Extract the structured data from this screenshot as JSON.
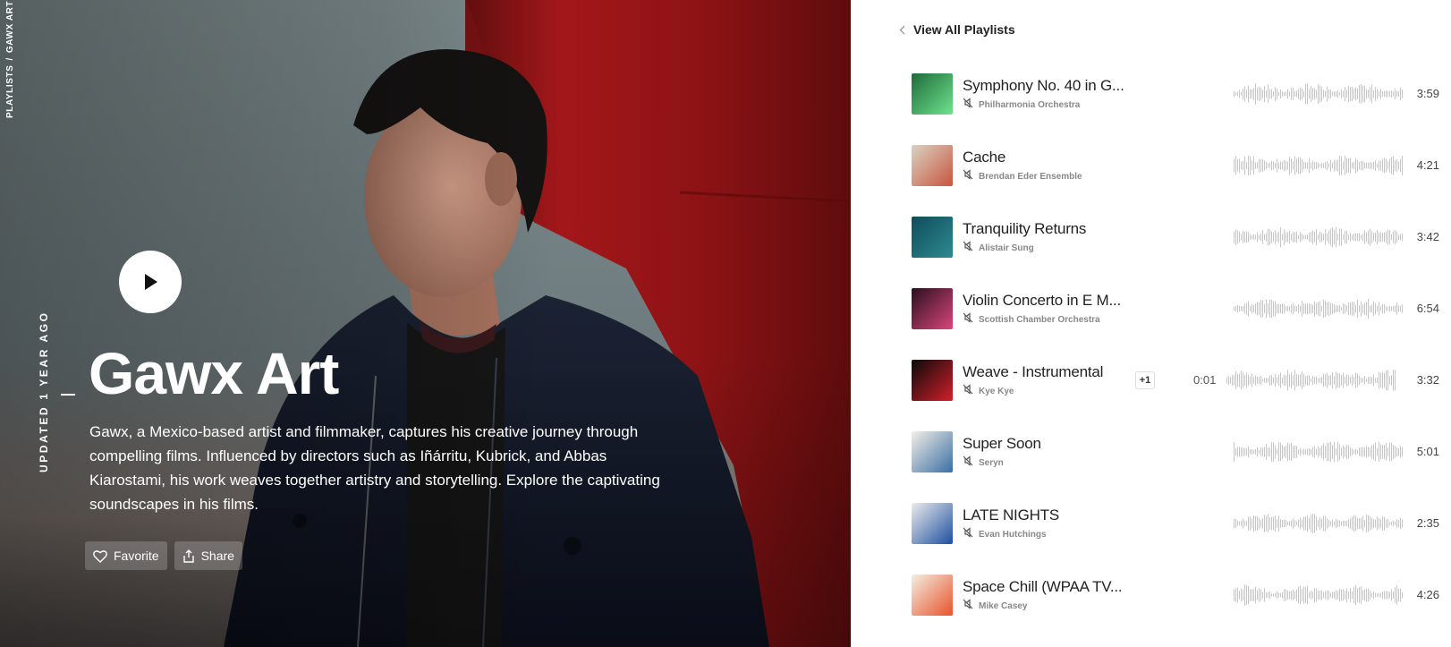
{
  "breadcrumb": {
    "root": "PLAYLISTS",
    "separator": "/",
    "current": "GAWX ART"
  },
  "hero": {
    "updated": "UPDATED 1 YEAR AGO",
    "title": "Gawx Art",
    "description": "Gawx, a Mexico-based artist and filmmaker, captures his creative journey through compelling films. Influenced by directors such as Iñárritu, Kubrick, and Abbas Kiarostami, his work weaves together artistry and storytelling. Explore the captivating soundscapes in his films.",
    "favorite_label": "Favorite",
    "share_label": "Share",
    "play_icon": "play-icon"
  },
  "nav": {
    "back_label": "View All Playlists"
  },
  "tracks": [
    {
      "title": "Symphony No. 40 in G...",
      "artist": "Philharmonia Orchestra",
      "duration": "3:59",
      "cover": [
        "#1f6b3a",
        "#6ee38d"
      ]
    },
    {
      "title": "Cache",
      "artist": "Brendan Eder Ensemble",
      "duration": "4:21",
      "cover": [
        "#d9d2c3",
        "#c8553d"
      ]
    },
    {
      "title": "Tranquility Returns",
      "artist": "Alistair Sung",
      "duration": "3:42",
      "cover": [
        "#0f4c5c",
        "#2e8a8f"
      ]
    },
    {
      "title": "Violin Concerto in E M...",
      "artist": "Scottish Chamber Orchestra",
      "duration": "6:54",
      "cover": [
        "#2a0f1f",
        "#d9467a"
      ]
    },
    {
      "title": "Weave - Instrumental",
      "artist": "Kye Kye",
      "duration": "3:32",
      "extra_artists": "+1",
      "elapsed": "0:01",
      "progress": 0.02,
      "cover": [
        "#0a0a0a",
        "#d11f2a"
      ]
    },
    {
      "title": "Super Soon",
      "artist": "Seryn",
      "duration": "5:01",
      "cover": [
        "#f3efe6",
        "#3a6ea5"
      ]
    },
    {
      "title": "LATE NIGHTS",
      "artist": "Evan Hutchings",
      "duration": "2:35",
      "cover": [
        "#ececec",
        "#1e4fa0"
      ]
    },
    {
      "title": "Space Chill (WPAA TV...",
      "artist": "Mike Casey",
      "duration": "4:26",
      "cover": [
        "#f4efe2",
        "#e8522a"
      ]
    }
  ],
  "colors": {
    "waveform": "#c3c7c5",
    "muted_icon": "#555555",
    "accent_red": "#8f0f0f"
  }
}
